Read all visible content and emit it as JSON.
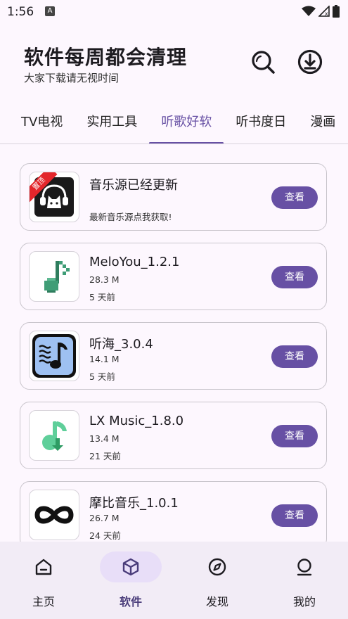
{
  "status": {
    "time": "1:56",
    "notif_letter": "A"
  },
  "header": {
    "title": "软件每周都会清理",
    "subtitle": "大家下载请无视时间"
  },
  "tabs": [
    {
      "label": "TV电视"
    },
    {
      "label": "实用工具"
    },
    {
      "label": "听歌好软",
      "active": true
    },
    {
      "label": "听书度日"
    },
    {
      "label": "漫画"
    }
  ],
  "cards": [
    {
      "title": "音乐源已经更新",
      "desc": "最新音乐源点我获取!",
      "badge": "置顶",
      "button": "查看",
      "icon": "music-source-cat-icon"
    },
    {
      "title": "MeloYou_1.2.1",
      "size": "28.3 M",
      "time": "5 天前",
      "button": "查看",
      "icon": "pixel-music-note-icon"
    },
    {
      "title": "听海_3.0.4",
      "size": "14.1 M",
      "time": "5 天前",
      "button": "查看",
      "icon": "tinghai-note-icon"
    },
    {
      "title": "LX Music_1.8.0",
      "size": "13.4 M",
      "time": "21 天前",
      "button": "查看",
      "icon": "lx-music-icon"
    },
    {
      "title": "摩比音乐_1.0.1",
      "size": "26.7 M",
      "time": "24 天前",
      "button": "查看",
      "icon": "infinity-icon"
    }
  ],
  "nav": [
    {
      "label": "主页",
      "icon": "home-icon"
    },
    {
      "label": "软件",
      "icon": "box-icon",
      "active": true
    },
    {
      "label": "发现",
      "icon": "compass-icon"
    },
    {
      "label": "我的",
      "icon": "profile-icon"
    }
  ],
  "colors": {
    "accent": "#6750a4",
    "background": "#fdf7fe",
    "nav_bg": "#f2ecf6",
    "pill": "#e8def8",
    "badge": "#e3262b"
  }
}
